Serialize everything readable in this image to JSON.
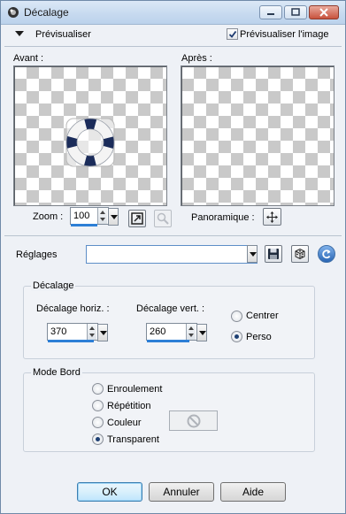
{
  "window": {
    "title": "Décalage"
  },
  "preview": {
    "toggle_label": "Prévisualiser",
    "preview_image_label": "Prévisualiser l'image",
    "preview_image_checked": true,
    "before_label": "Avant :",
    "after_label": "Après :"
  },
  "zoom": {
    "label": "Zoom :",
    "value": "100",
    "pan_label": "Panoramique :"
  },
  "settings": {
    "label": "Réglages",
    "value": ""
  },
  "offset": {
    "group_title": "Décalage",
    "horiz_label": "Décalage horiz. :",
    "horiz_value": "370",
    "vert_label": "Décalage vert. :",
    "vert_value": "260",
    "center_label": "Centrer",
    "custom_label": "Perso",
    "selected": "Perso"
  },
  "edge_mode": {
    "group_title": "Mode Bord",
    "options": [
      "Enroulement",
      "Répétition",
      "Couleur",
      "Transparent"
    ],
    "selected": "Transparent"
  },
  "buttons": {
    "ok": "OK",
    "cancel": "Annuler",
    "help": "Aide"
  }
}
